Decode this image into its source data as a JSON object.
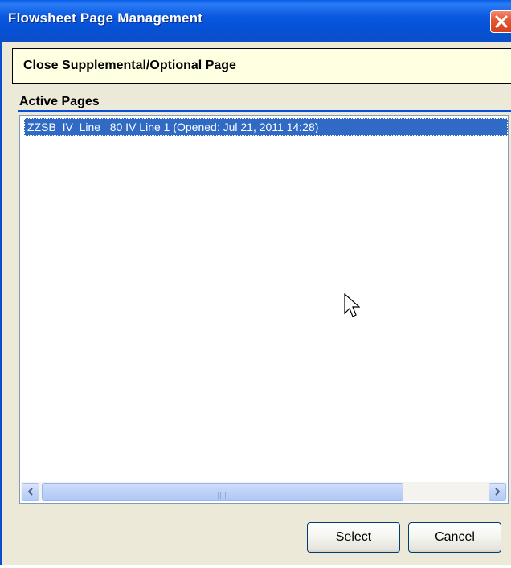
{
  "window": {
    "title": "Flowsheet Page Management"
  },
  "header": {
    "text": "Close Supplemental/Optional Page"
  },
  "active_pages": {
    "label": "Active Pages",
    "items": [
      {
        "text": "ZZSB_IV_Line   80 IV Line 1 (Opened: Jul 21, 2011 14:28)",
        "selected": true
      }
    ]
  },
  "buttons": {
    "select_label": "Select",
    "cancel_label": "Cancel"
  },
  "icons": {
    "close": "close-icon",
    "scroll_left": "chevron-left-icon",
    "scroll_right": "chevron-right-icon",
    "cursor": "mouse-pointer-icon"
  },
  "colors": {
    "titlebar": "#0a58e0",
    "selection": "#316ac5",
    "header_bg": "#ffffe1"
  }
}
